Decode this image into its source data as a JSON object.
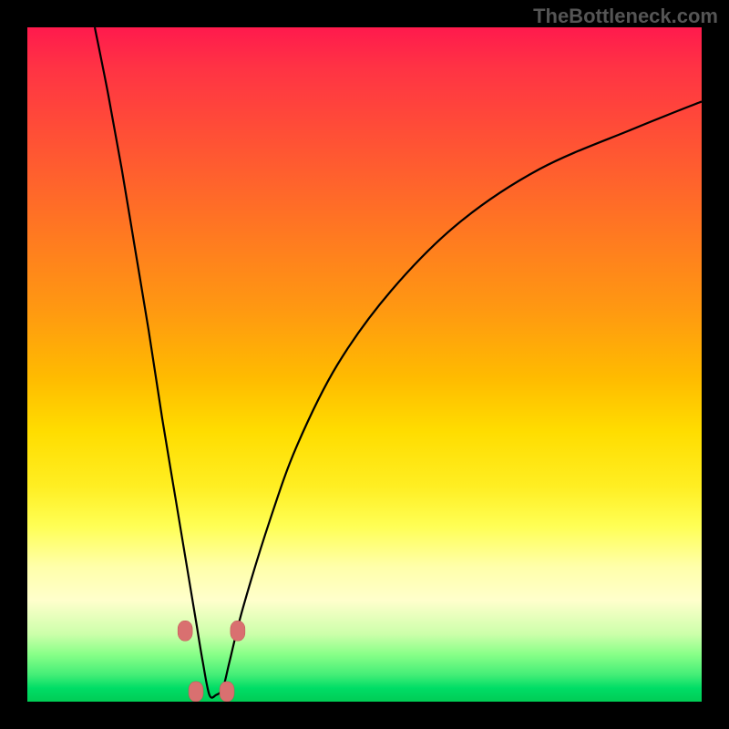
{
  "watermark": "TheBottleneck.com",
  "colors": {
    "background": "#000000",
    "gradient_top": "#ff1a4d",
    "gradient_bottom": "#00cc55",
    "curve": "#000000",
    "marker": "#d97070"
  },
  "chart_data": {
    "type": "line",
    "title": "",
    "xlabel": "",
    "ylabel": "",
    "xlim": [
      0,
      100
    ],
    "ylim": [
      0,
      100
    ],
    "series": [
      {
        "name": "bottleneck-curve",
        "description": "V-shaped curve with minimum near x≈27; left branch steep, right branch gradual",
        "x": [
          10,
          12,
          14,
          16,
          18,
          20,
          22,
          24,
          25,
          26,
          27,
          28,
          29,
          30,
          32,
          36,
          40,
          46,
          54,
          64,
          76,
          90,
          100
        ],
        "values": [
          100,
          90,
          79,
          67,
          55,
          42,
          30,
          18,
          12,
          6,
          1,
          1,
          2,
          6,
          14,
          27,
          38,
          50,
          61,
          71,
          79,
          85,
          89
        ]
      }
    ],
    "markers": [
      {
        "x": 23.4,
        "y": 10.5
      },
      {
        "x": 31.2,
        "y": 10.5
      },
      {
        "x": 25.0,
        "y": 1.5
      },
      {
        "x": 29.6,
        "y": 1.5
      }
    ]
  }
}
